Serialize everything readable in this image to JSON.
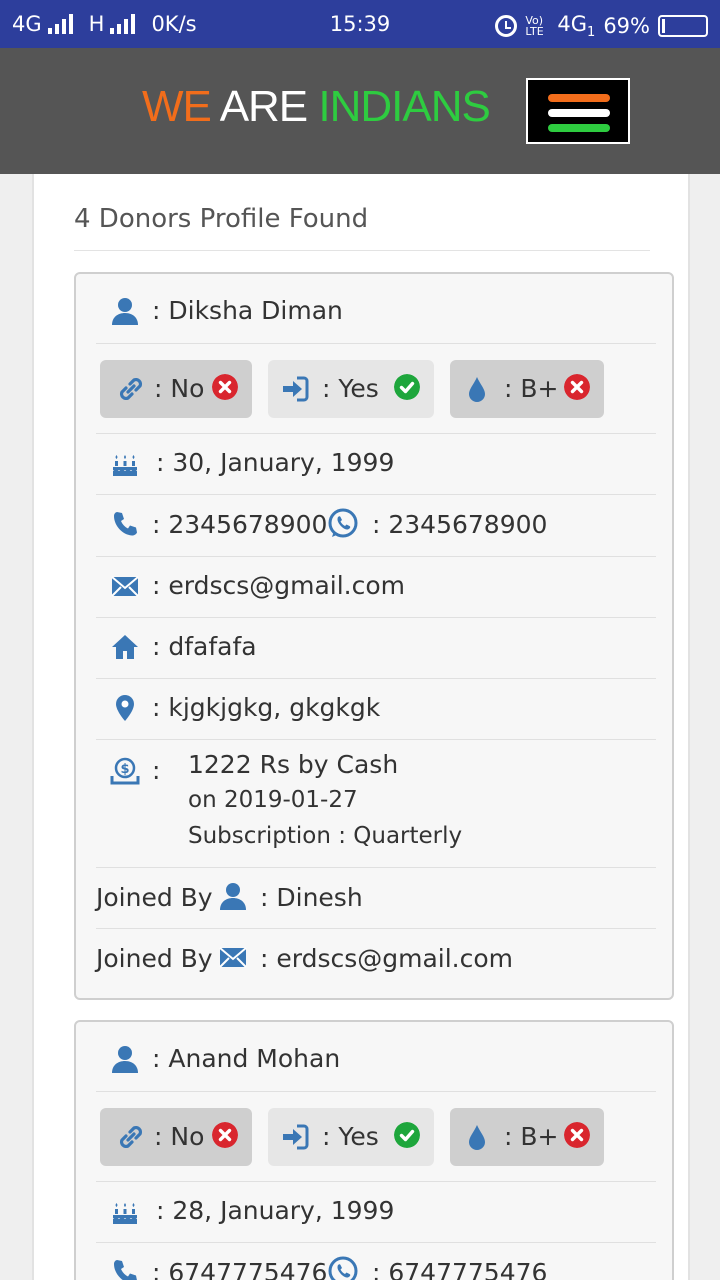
{
  "status_bar": {
    "network_left": "4G",
    "network_mid": "H",
    "speed": "0K/s",
    "time": "15:39",
    "volte": "Vo) LTE",
    "network_right": "4G",
    "sim": "1",
    "battery": "69%"
  },
  "header": {
    "brand_we": "WE",
    "brand_are": "ARE",
    "brand_indians": "INDIANS",
    "colors": {
      "saffron": "#f26d1b",
      "white": "#ffffff",
      "green": "#2ecc40",
      "bar": "#555555",
      "status_bar": "#2d3e9c"
    }
  },
  "results": {
    "count_text": "4 Donors Profile Found"
  },
  "donors": [
    {
      "name": ": Diksha Diman",
      "linked": ": No",
      "joined": ": Yes",
      "blood_group": ": B+",
      "dob": ": 30, January, 1999",
      "phone": ": 2345678900",
      "whatsapp": ": 2345678900",
      "email": ": erdscs@gmail.com",
      "home": ": dfafafa",
      "location": ": kjgkjgkg, gkgkgk",
      "payment_colon": ":",
      "payment_amount": "1222 Rs by Cash",
      "payment_date": "on 2019-01-27",
      "payment_subscription": "Subscription : Quarterly",
      "joined_by_label": "Joined By",
      "joined_by_name": ": Dinesh",
      "joined_by_email": ": erdscs@gmail.com"
    },
    {
      "name": ": Anand Mohan",
      "linked": ": No",
      "joined": ": Yes",
      "blood_group": ": B+",
      "dob": ": 28, January, 1999",
      "phone": ": 6747775476",
      "whatsapp": ": 6747775476"
    }
  ],
  "icons": {
    "user": "user-icon",
    "link": "link-icon",
    "sign_in": "sign-in-icon",
    "blood_drop": "blood-drop-icon",
    "birthday_cake": "birthday-cake-icon",
    "phone": "phone-icon",
    "whatsapp": "whatsapp-icon",
    "envelope": "envelope-icon",
    "home": "home-icon",
    "map_marker": "map-marker-icon",
    "money": "money-icon",
    "times_circle": "times-circle-icon",
    "check_circle": "check-circle-icon"
  },
  "accent_color": "#3a77b5"
}
